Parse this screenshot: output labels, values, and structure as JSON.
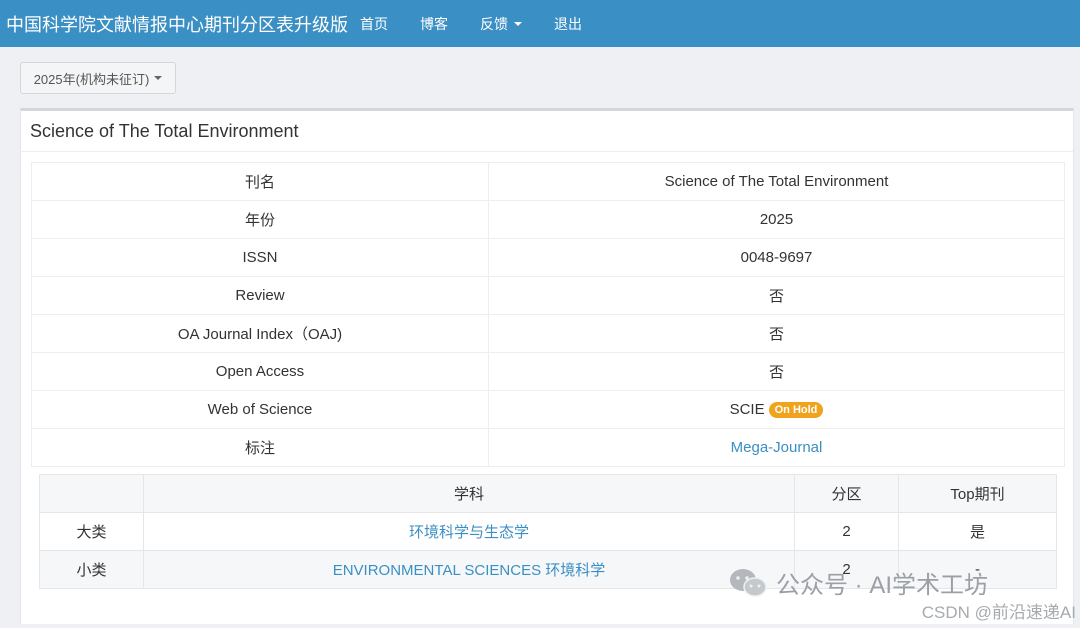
{
  "navbar": {
    "brand": "中国科学院文献情报中心期刊分区表升级版",
    "items": [
      {
        "label": "首页"
      },
      {
        "label": "博客"
      },
      {
        "label": "反馈"
      },
      {
        "label": "退出"
      }
    ]
  },
  "year_selector": {
    "label": "2025年(机构未征订)"
  },
  "journal": {
    "title": "Science of The Total Environment",
    "rows": [
      {
        "key": "刊名",
        "value": "Science of The Total Environment"
      },
      {
        "key": "年份",
        "value": "2025"
      },
      {
        "key": "ISSN",
        "value": "0048-9697"
      },
      {
        "key": "Review",
        "value": "否"
      },
      {
        "key": "OA Journal Index（OAJ)",
        "value": "否"
      },
      {
        "key": "Open Access",
        "value": "否"
      },
      {
        "key": "Web of Science",
        "value": "SCIE",
        "badge": "On Hold"
      },
      {
        "key": "标注",
        "value": "Mega-Journal"
      }
    ]
  },
  "subjects": {
    "headers": [
      "",
      "学科",
      "分区",
      "Top期刊"
    ],
    "rows": [
      {
        "category": "大类",
        "subject": "环境科学与生态学",
        "zone": "2",
        "top": "是"
      },
      {
        "category": "小类",
        "subject": "ENVIRONMENTAL SCIENCES 环境科学",
        "zone": "2",
        "top": "-"
      }
    ]
  },
  "watermark": {
    "line1": "公众号 · AI学术工坊",
    "line2": "CSDN @前沿速递AI"
  },
  "colors": {
    "navbar": "#3a8fc4",
    "link": "#3a8fc4",
    "badge": "#f0a31c"
  }
}
